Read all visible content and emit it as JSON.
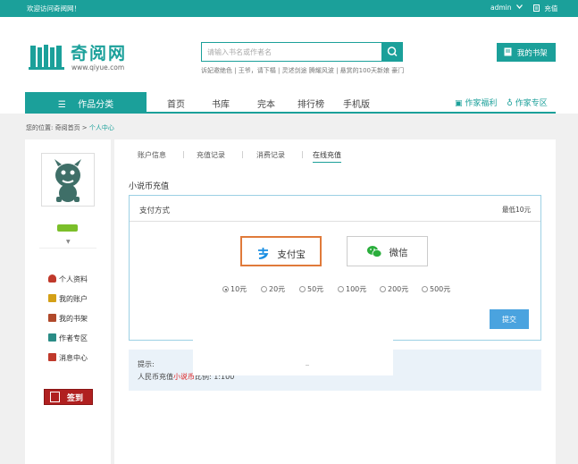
{
  "topbar": {
    "welcome": "欢迎访问奇阅网！",
    "user": "admin",
    "recharge": "充值"
  },
  "header": {
    "logo_text": "奇阅网",
    "logo_url": "www.qiyue.com",
    "search_placeholder": "请输入书名或作者名",
    "hot_links": "诉妃邀绝色 | 王爷，请下榻 | 灵述剑途 腾耀风波 | 悬赏的100天新娘 豪门",
    "shelf_button": "我的书架"
  },
  "nav": {
    "category": "作品分类",
    "items": [
      "首页",
      "书库",
      "完本",
      "排行榜",
      "手机版"
    ],
    "writer_welfare": "作家福利",
    "writer_zone": "作家专区"
  },
  "breadcrumb": {
    "prefix": "您的位置: 奇阅首页 >",
    "current": "个人中心"
  },
  "sidebar": {
    "menu": [
      {
        "label": "个人资料",
        "icon": "person-icon",
        "color": "#c0392b"
      },
      {
        "label": "我的账户",
        "icon": "account-icon",
        "color": "#d4a017"
      },
      {
        "label": "我的书架",
        "icon": "bookshelf-icon",
        "color": "#b0492b"
      },
      {
        "label": "作者专区",
        "icon": "author-icon",
        "color": "#2a8c86"
      },
      {
        "label": "消息中心",
        "icon": "message-icon",
        "color": "#c0392b"
      }
    ],
    "sign_button": "签到"
  },
  "tabs": [
    "账户信息",
    "充值记录",
    "消费记录",
    "在线充值"
  ],
  "active_tab": "在线充值",
  "section_title": "小说币充值",
  "payment": {
    "method_label": "支付方式",
    "minimum": "最低10元",
    "alipay": "支付宝",
    "wechat": "微信",
    "amounts": [
      "10元",
      "20元",
      "50元",
      "100元",
      "200元",
      "500元"
    ],
    "selected_amount": "10元",
    "submit": "提交"
  },
  "tips": {
    "title": "提示:",
    "line_prefix": "人民币充值",
    "line_red": "小说币",
    "line_suffix": "比例: 1:100"
  },
  "colors": {
    "brand": "#1ba09a",
    "alipay_border": "#e07a3a",
    "submit": "#4aa3df",
    "sign": "#b02020"
  }
}
